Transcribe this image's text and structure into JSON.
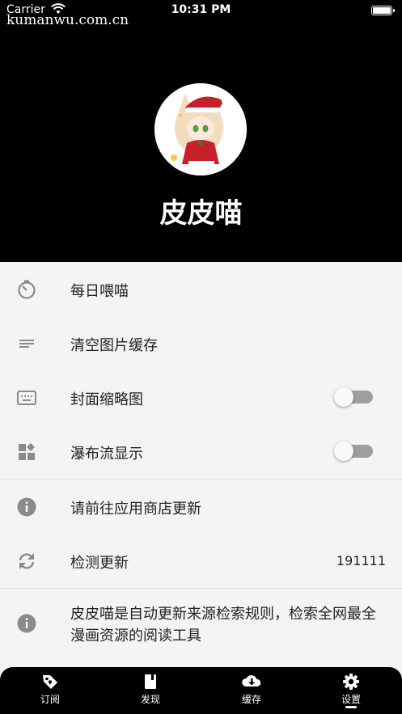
{
  "status_bar": {
    "carrier": "Carrier",
    "time": "10:31 PM"
  },
  "watermark": "kumanwu.com.cn",
  "profile": {
    "name": "皮皮喵"
  },
  "settings": {
    "items": [
      {
        "label": "每日喂喵",
        "icon": "timer-icon"
      },
      {
        "label": "清空图片缓存",
        "icon": "lines-icon"
      },
      {
        "label": "封面缩略图",
        "icon": "keyboard-icon",
        "toggle": false
      },
      {
        "label": "瀑布流显示",
        "icon": "widgets-icon",
        "toggle": false
      }
    ],
    "update_store": {
      "label": "请前往应用商店更新",
      "icon": "info-icon"
    },
    "check_update": {
      "label": "检测更新",
      "value": "191111",
      "icon": "sync-icon"
    },
    "about": {
      "label": "皮皮喵是自动更新来源检索规则，检索全网最全漫画资源的阅读工具",
      "icon": "info-icon"
    }
  },
  "tabs": [
    {
      "label": "订阅",
      "icon": "tag-icon"
    },
    {
      "label": "发现",
      "icon": "book-icon"
    },
    {
      "label": "缓存",
      "icon": "cloud-download-icon"
    },
    {
      "label": "设置",
      "icon": "gear-icon",
      "active": true
    }
  ]
}
